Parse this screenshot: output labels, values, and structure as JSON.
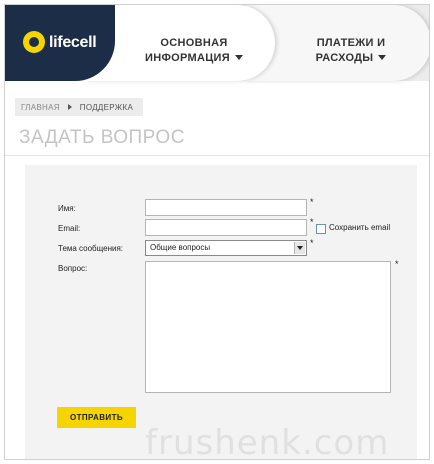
{
  "brand": {
    "logo_text": "lifecell",
    "accent": "#f5d400",
    "navy": "#1c2e47"
  },
  "nav": [
    {
      "label": "ОСНОВНАЯ\nИНФОРМАЦИЯ"
    },
    {
      "label": "ПЛАТЕЖИ И\nРАСХОДЫ"
    }
  ],
  "breadcrumb": {
    "home": "ГЛАВНАЯ",
    "current": "ПОДДЕРЖКА"
  },
  "page_title": "ЗАДАТЬ ВОПРОС",
  "form": {
    "name_label": "Имя:",
    "email_label": "Email:",
    "topic_label": "Тема сообщения:",
    "question_label": "Вопрос:",
    "required_mark": "*",
    "topic_selected": "Общие вопросы",
    "save_email_label": "Сохранить email",
    "submit_label": "ОТПРАВИТЬ"
  },
  "watermark": "frushenk.com"
}
